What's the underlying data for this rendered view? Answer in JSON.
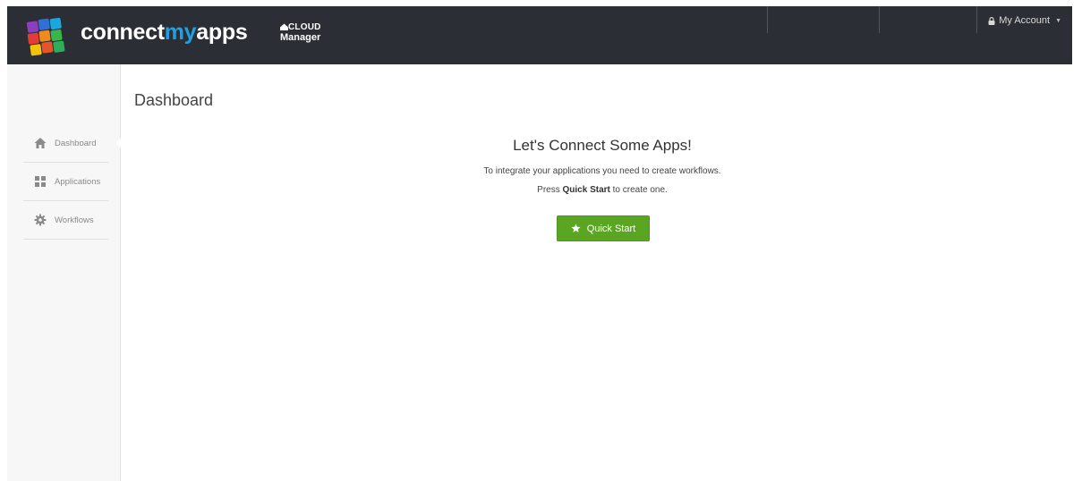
{
  "header": {
    "brand_part1": "connect",
    "brand_part2": "my",
    "brand_part3": "apps",
    "cloud_line1": "CLOUD",
    "cloud_line2": "Manager",
    "account_label": "My Account",
    "account_icon": "lock-icon",
    "account_caret_icon": "chevron-down-icon"
  },
  "sidebar": {
    "items": [
      {
        "label": "Dashboard",
        "icon": "home-icon",
        "active": true
      },
      {
        "label": "Applications",
        "icon": "grid-icon",
        "active": false
      },
      {
        "label": "Workflows",
        "icon": "gear-icon",
        "active": false
      }
    ]
  },
  "main": {
    "page_title": "Dashboard",
    "hero_title": "Let's Connect Some Apps!",
    "hero_line1": "To integrate your applications you need to create workflows.",
    "hero_line2_pre": "Press ",
    "hero_line2_bold": "Quick Start",
    "hero_line2_post": " to create one.",
    "quick_start_label": "Quick Start",
    "quick_start_icon": "star-icon"
  },
  "colors": {
    "header_bg": "#2b2f35",
    "brand_accent": "#1ea0e6",
    "button_green": "#5aa623",
    "sidebar_bg": "#f7f7f7"
  }
}
